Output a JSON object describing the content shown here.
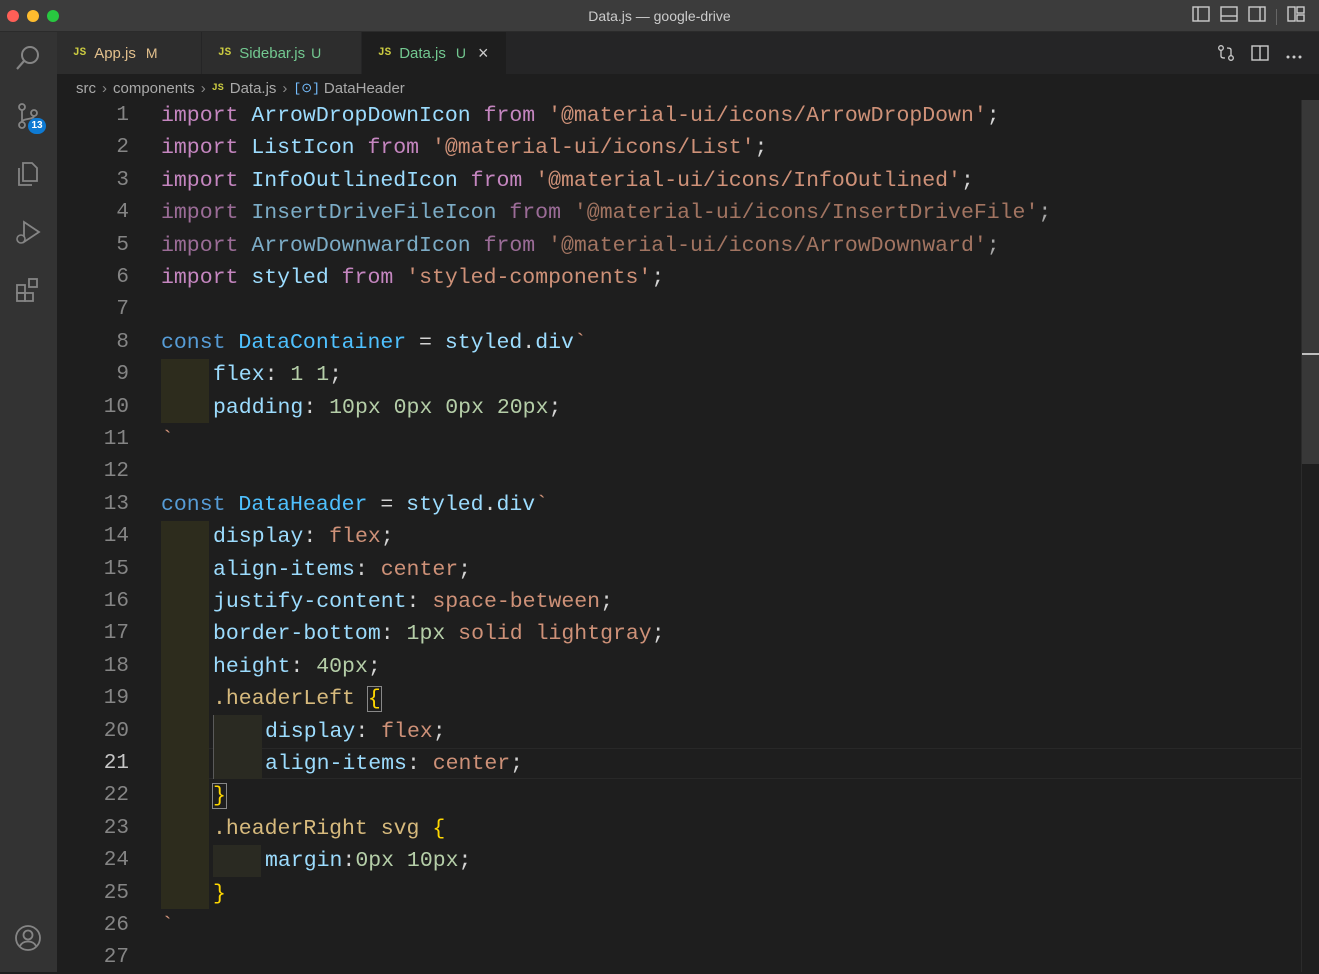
{
  "window": {
    "title": "Data.js — google-drive"
  },
  "activity_bar": {
    "scm_badge": "13"
  },
  "tabs": [
    {
      "label": "App.js",
      "status": "M",
      "icon": "JS"
    },
    {
      "label": "Sidebar.js",
      "status": "U",
      "icon": "JS"
    },
    {
      "label": "Data.js",
      "status": "U",
      "icon": "JS",
      "close": "×"
    }
  ],
  "breadcrumb": {
    "folder1": "src",
    "folder2": "components",
    "file_icon": "JS",
    "file": "Data.js",
    "symbol_icon": "[⊙]",
    "symbol": "DataHeader"
  },
  "editor": {
    "current_line": "21",
    "line_numbers": [
      "1",
      "2",
      "3",
      "4",
      "5",
      "6",
      "7",
      "8",
      "9",
      "10",
      "11",
      "12",
      "13",
      "14",
      "15",
      "16",
      "17",
      "18",
      "19",
      "20",
      "21",
      "22",
      "23",
      "24",
      "25",
      "26",
      "27"
    ],
    "t": {
      "import": "import",
      "from": "from",
      "const": "const",
      "semi": ";",
      "l1_id": "ArrowDropDownIcon",
      "l1_str": "'@material-ui/icons/ArrowDropDown'",
      "l2_id": "ListIcon",
      "l2_str": "'@material-ui/icons/List'",
      "l3_id": "InfoOutlinedIcon",
      "l3_str": "'@material-ui/icons/InfoOutlined'",
      "l4_id": "InsertDriveFileIcon",
      "l4_str": "'@material-ui/icons/InsertDriveFile'",
      "l5_id": "ArrowDownwardIcon",
      "l5_str": "'@material-ui/icons/ArrowDownward'",
      "l6_id": "styled",
      "l6_str": "'styled-components'",
      "l8_name": "DataContainer",
      "eq": " = ",
      "styled": "styled",
      "dot": ".",
      "div": "div",
      "tick": "`",
      "l9_prop": "flex",
      "l9_val": "1 1",
      "l10_prop": "padding",
      "l10_val": "10px 0px 0px 20px",
      "l13_name": "DataHeader",
      "l14_prop": "display",
      "l14_val": "flex",
      "l15_prop": "align-items",
      "l15_val": "center",
      "l16_prop": "justify-content",
      "l16_val": "space-between",
      "l17_prop": "border-bottom",
      "l17_num": "1px",
      "l17_val": "solid lightgray",
      "l18_prop": "height",
      "l18_val": "40px",
      "l19_sel": ".headerLeft ",
      "ob": "{",
      "cb": "}",
      "l20_prop": "display",
      "l20_val": "flex",
      "l21_prop": "align-items",
      "l21_val": "center",
      "l23_sel": ".headerRight svg ",
      "l24_prop": "margin",
      "l24_val": "0px 10px",
      "colon": ": ",
      "colon_nospace": ":"
    }
  },
  "colors": {
    "keyword": "#c586c0",
    "storage": "#569cd6",
    "variable": "#9cdcfe",
    "string": "#ce9178",
    "number": "#b5cea8",
    "selector": "#d7ba7d",
    "bracket": "#ffd700"
  }
}
